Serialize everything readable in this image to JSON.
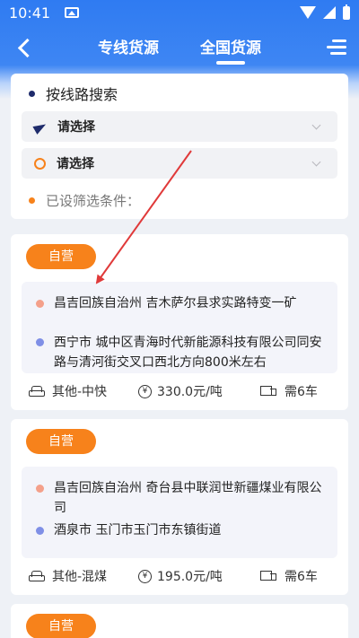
{
  "status_bar": {
    "time": "10:41"
  },
  "nav": {
    "tabs": [
      {
        "label": "专线货源",
        "active": false
      },
      {
        "label": "全国货源",
        "active": true
      }
    ]
  },
  "filter": {
    "route_search_label": "按线路搜索",
    "origin_placeholder": "请选择",
    "destination_placeholder": "请选择",
    "conditions_label": "已设筛选条件："
  },
  "orders": [
    {
      "badge": "自营",
      "from": "昌吉回族自治州 吉木萨尔县求实路特变一矿",
      "to": "西宁市 城中区青海时代新能源科技有限公司同安路与清河街交叉口西北方向800米左右",
      "cargo": "其他-中快",
      "price": "330.0元/吨",
      "vehicles": "需6车"
    },
    {
      "badge": "自营",
      "from": "昌吉回族自治州 奇台县中联润世新疆煤业有限公司",
      "to": "酒泉市 玉门市玉门市东镇街道",
      "cargo": "其他-混煤",
      "price": "195.0元/吨",
      "vehicles": "需6车"
    },
    {
      "badge": "自营"
    }
  ],
  "colors": {
    "brand_blue": "#2f7bf2",
    "accent_orange": "#f7821b",
    "from_dot": "#f4a08a",
    "to_dot": "#7f8fe6",
    "annotation_arrow": "#e03a3a"
  }
}
